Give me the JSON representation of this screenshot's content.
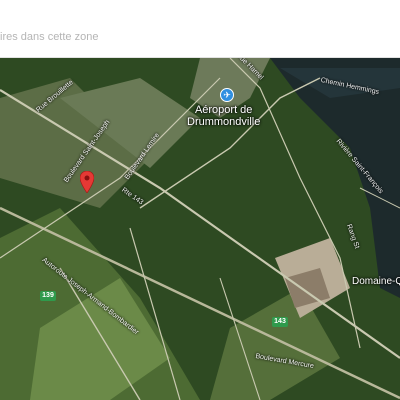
{
  "search": {
    "placeholder_text": "ires dans cette zone"
  },
  "map": {
    "type": "satellite",
    "airport": {
      "line1": "Aéroport de",
      "line2": "Drummondville",
      "icon": "airport-icon"
    },
    "places": {
      "domaine": "Domaine-Qu"
    },
    "roads": {
      "boulevard_saint_joseph": "Boulevard Saint-Joseph",
      "route_143": "Rte 143",
      "boulevard_lemire": "Boulevard Lemire",
      "autoroute": "Autoroute Joseph-Armand-Bombardier",
      "boulevard_mercure": "Boulevard Mercure",
      "rang": "Rang St",
      "riviere_hamel": "Rue Hamel",
      "rue_faucher": "Rue Brouillette",
      "chemin": "Chemin Hemmings"
    },
    "river": {
      "name": "Rivière Saint-François"
    },
    "shields": {
      "a55": "139",
      "r143": "143"
    },
    "marker": {
      "icon": "location-pin-icon",
      "color": "#e53935"
    },
    "colors": {
      "forest": "#2e4a22",
      "field": "#5a7a3a",
      "river": "#1d2a2c",
      "road": "#c9c9b0",
      "highway": "#b8b89a"
    }
  }
}
